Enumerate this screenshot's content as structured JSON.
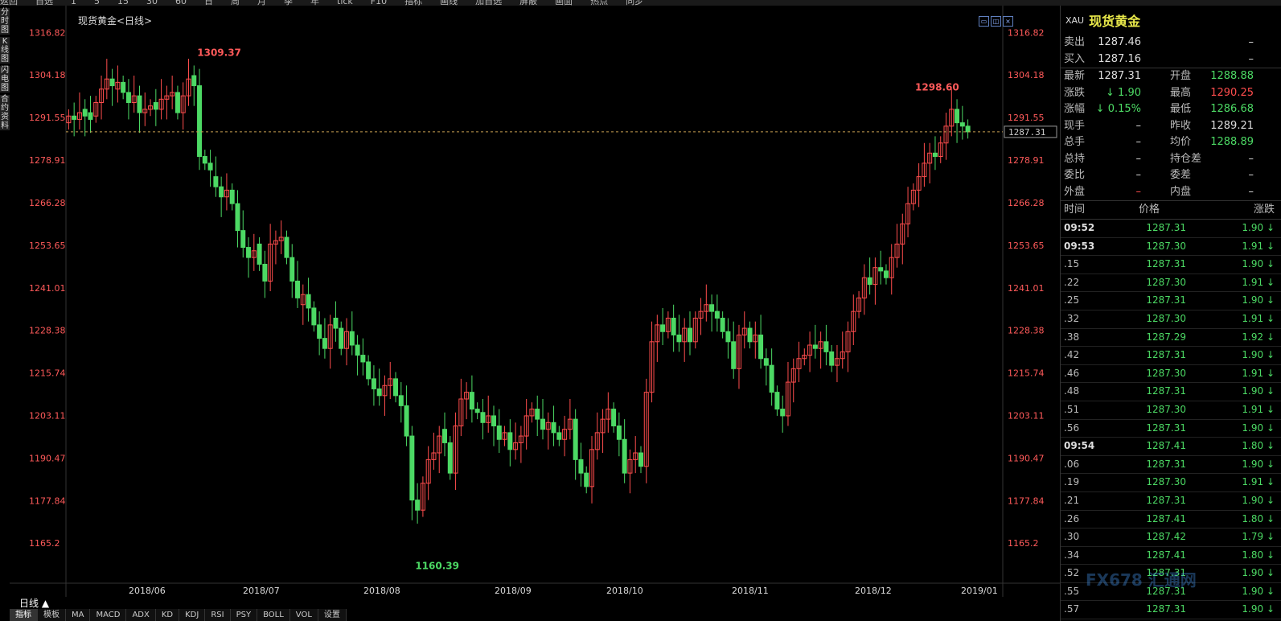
{
  "toolbar": {
    "items": [
      "返回",
      "自选",
      "1",
      "5",
      "15",
      "30",
      "60",
      "日",
      "周",
      "月",
      "季",
      "年",
      "tick",
      "F10",
      "指标",
      "画线",
      "加自选",
      "屏蔽",
      "画面",
      "热点",
      "同步"
    ]
  },
  "left_tabs": [
    "分时图",
    "K线图",
    "闪电图",
    "合约资料"
  ],
  "chart": {
    "title": "现货黄金<日线>",
    "period_label": "日线 ▲",
    "y_ticks": [
      1316.82,
      1304.18,
      1291.55,
      1278.91,
      1266.28,
      1253.65,
      1241.01,
      1228.38,
      1215.74,
      1203.11,
      1190.47,
      1177.84,
      1165.2
    ],
    "x_labels": [
      "2018/06",
      "2018/07",
      "2018/08",
      "2018/09",
      "2018/10",
      "2018/11",
      "2018/12",
      "2019/01"
    ],
    "high_label": "1309.37",
    "low_label": "1160.39",
    "recent_high_label": "1298.60",
    "current_price_label": "1287.31",
    "up_color": "#ff4d4d",
    "down_color": "#4cd964"
  },
  "chart_data": {
    "type": "candlestick",
    "title": "现货黄金<日线>",
    "x_labels": [
      "2018/06",
      "2018/07",
      "2018/08",
      "2018/09",
      "2018/10",
      "2018/11",
      "2018/12",
      "2019/01"
    ],
    "ylim": [
      1160.0,
      1320.0
    ],
    "y_ticks": [
      1316.82,
      1304.18,
      1291.55,
      1278.91,
      1266.28,
      1253.65,
      1241.01,
      1228.38,
      1215.74,
      1203.11,
      1190.47,
      1177.84,
      1165.2
    ],
    "highest": 1309.37,
    "lowest": 1160.39,
    "last": 1287.31,
    "closes": [
      1292,
      1291,
      1293,
      1292,
      1291,
      1296,
      1300,
      1303,
      1301,
      1302,
      1299,
      1296,
      1298,
      1293,
      1294,
      1295,
      1294,
      1297,
      1298,
      1299,
      1293,
      1298,
      1303,
      1301,
      1280,
      1278,
      1276,
      1271,
      1268,
      1270,
      1266,
      1258,
      1253,
      1250,
      1252,
      1248,
      1243,
      1254,
      1255,
      1256,
      1250,
      1243,
      1238,
      1239,
      1235,
      1230,
      1226,
      1223,
      1230,
      1229,
      1223,
      1228,
      1224,
      1221,
      1219,
      1214,
      1211,
      1209,
      1212,
      1214,
      1209,
      1206,
      1197,
      1178,
      1175,
      1183,
      1190,
      1192,
      1197,
      1195,
      1186,
      1200,
      1208,
      1210,
      1205,
      1204,
      1201,
      1203,
      1200,
      1196,
      1198,
      1193,
      1195,
      1197,
      1203,
      1205,
      1202,
      1199,
      1201,
      1198,
      1196,
      1199,
      1202,
      1190,
      1186,
      1182,
      1193,
      1198,
      1202,
      1205,
      1200,
      1196,
      1186,
      1190,
      1192,
      1188,
      1210,
      1225,
      1230,
      1228,
      1232,
      1227,
      1225,
      1229,
      1225,
      1232,
      1234,
      1236,
      1234,
      1232,
      1228,
      1225,
      1217,
      1227,
      1229,
      1225,
      1227,
      1220,
      1218,
      1210,
      1205,
      1203,
      1213,
      1217,
      1220,
      1221,
      1224,
      1223,
      1225,
      1222,
      1218,
      1220,
      1222,
      1228,
      1234,
      1238,
      1244,
      1242,
      1247,
      1246,
      1244,
      1250,
      1254,
      1260,
      1266,
      1270,
      1274,
      1278,
      1281,
      1280,
      1284,
      1289,
      1294,
      1290,
      1289,
      1287.31
    ],
    "opens": [
      1290,
      1292,
      1291,
      1294,
      1293,
      1292,
      1296,
      1300,
      1303,
      1300,
      1302,
      1299,
      1296,
      1298,
      1293,
      1294,
      1296,
      1294,
      1297,
      1298,
      1299,
      1293,
      1298,
      1304,
      1301,
      1280,
      1278,
      1274,
      1271,
      1268,
      1270,
      1266,
      1258,
      1253,
      1250,
      1254,
      1248,
      1243,
      1254,
      1255,
      1256,
      1250,
      1243,
      1236,
      1239,
      1235,
      1230,
      1226,
      1223,
      1232,
      1229,
      1223,
      1228,
      1224,
      1221,
      1219,
      1214,
      1211,
      1209,
      1212,
      1214,
      1209,
      1206,
      1197,
      1178,
      1175,
      1183,
      1190,
      1192,
      1199,
      1195,
      1186,
      1200,
      1208,
      1210,
      1205,
      1204,
      1201,
      1203,
      1200,
      1196,
      1198,
      1193,
      1195,
      1197,
      1203,
      1205,
      1202,
      1199,
      1201,
      1198,
      1196,
      1199,
      1202,
      1190,
      1186,
      1182,
      1193,
      1198,
      1202,
      1205,
      1200,
      1196,
      1186,
      1190,
      1192,
      1188,
      1210,
      1225,
      1230,
      1228,
      1232,
      1227,
      1225,
      1229,
      1225,
      1232,
      1234,
      1236,
      1234,
      1232,
      1228,
      1225,
      1217,
      1227,
      1229,
      1225,
      1227,
      1220,
      1218,
      1210,
      1205,
      1203,
      1213,
      1217,
      1220,
      1221,
      1224,
      1223,
      1225,
      1222,
      1218,
      1220,
      1222,
      1228,
      1234,
      1238,
      1244,
      1242,
      1247,
      1246,
      1244,
      1250,
      1254,
      1260,
      1266,
      1270,
      1274,
      1278,
      1281,
      1280,
      1284,
      1289,
      1294,
      1290,
      1289
    ]
  },
  "panel": {
    "code": "XAU",
    "name": "现货黄金",
    "quotes": [
      {
        "l1": "卖出",
        "v1": "1287.46",
        "c1": "white",
        "l2": "",
        "v2": "–",
        "c2": "white"
      },
      {
        "l1": "买入",
        "v1": "1287.16",
        "c1": "white",
        "l2": "",
        "v2": "–",
        "c2": "white"
      },
      {
        "l1": "最新",
        "v1": "1287.31",
        "c1": "white",
        "l2": "开盘",
        "v2": "1288.88",
        "c2": "green"
      },
      {
        "l1": "涨跌",
        "v1": "↓ 1.90",
        "c1": "green",
        "l2": "最高",
        "v2": "1290.25",
        "c2": "red"
      },
      {
        "l1": "涨幅",
        "v1": "↓ 0.15%",
        "c1": "green",
        "l2": "最低",
        "v2": "1286.68",
        "c2": "green"
      },
      {
        "l1": "现手",
        "v1": "–",
        "c1": "white",
        "l2": "昨收",
        "v2": "1289.21",
        "c2": "white"
      },
      {
        "l1": "总手",
        "v1": "–",
        "c1": "white",
        "l2": "均价",
        "v2": "1288.89",
        "c2": "green"
      },
      {
        "l1": "总持",
        "v1": "–",
        "c1": "white",
        "l2": "持仓差",
        "v2": "–",
        "c2": "white"
      },
      {
        "l1": "委比",
        "v1": "–",
        "c1": "white",
        "l2": "委差",
        "v2": "–",
        "c2": "white"
      },
      {
        "l1": "外盘",
        "v1": "–",
        "c1": "red",
        "l2": "内盘",
        "v2": "–",
        "c2": "white"
      }
    ],
    "tick_headers": [
      "时间",
      "价格",
      "涨跌"
    ],
    "ticks": [
      {
        "time": "09:52",
        "full": true,
        "price": "1287.31",
        "chg": "1.90 ↓"
      },
      {
        "time": "09:53",
        "full": true,
        "price": "1287.30",
        "chg": "1.91 ↓"
      },
      {
        "time": ".15",
        "full": false,
        "price": "1287.31",
        "chg": "1.90 ↓"
      },
      {
        "time": ".22",
        "full": false,
        "price": "1287.30",
        "chg": "1.91 ↓"
      },
      {
        "time": ".25",
        "full": false,
        "price": "1287.31",
        "chg": "1.90 ↓"
      },
      {
        "time": ".32",
        "full": false,
        "price": "1287.30",
        "chg": "1.91 ↓"
      },
      {
        "time": ".38",
        "full": false,
        "price": "1287.29",
        "chg": "1.92 ↓"
      },
      {
        "time": ".42",
        "full": false,
        "price": "1287.31",
        "chg": "1.90 ↓"
      },
      {
        "time": ".46",
        "full": false,
        "price": "1287.30",
        "chg": "1.91 ↓"
      },
      {
        "time": ".48",
        "full": false,
        "price": "1287.31",
        "chg": "1.90 ↓"
      },
      {
        "time": ".51",
        "full": false,
        "price": "1287.30",
        "chg": "1.91 ↓"
      },
      {
        "time": ".56",
        "full": false,
        "price": "1287.31",
        "chg": "1.90 ↓"
      },
      {
        "time": "09:54",
        "full": true,
        "price": "1287.41",
        "chg": "1.80 ↓"
      },
      {
        "time": ".06",
        "full": false,
        "price": "1287.31",
        "chg": "1.90 ↓"
      },
      {
        "time": ".19",
        "full": false,
        "price": "1287.30",
        "chg": "1.91 ↓"
      },
      {
        "time": ".21",
        "full": false,
        "price": "1287.31",
        "chg": "1.90 ↓"
      },
      {
        "time": ".26",
        "full": false,
        "price": "1287.41",
        "chg": "1.80 ↓"
      },
      {
        "time": ".30",
        "full": false,
        "price": "1287.42",
        "chg": "1.79 ↓"
      },
      {
        "time": ".34",
        "full": false,
        "price": "1287.41",
        "chg": "1.80 ↓"
      },
      {
        "time": ".52",
        "full": false,
        "price": "1287.31",
        "chg": "1.90 ↓"
      },
      {
        "time": ".55",
        "full": false,
        "price": "1287.31",
        "chg": "1.90 ↓"
      },
      {
        "time": ".57",
        "full": false,
        "price": "1287.31",
        "chg": "1.90 ↓"
      }
    ]
  },
  "indicators": [
    "指标",
    "模板",
    "MA",
    "MACD",
    "ADX",
    "KD",
    "KDJ",
    "RSI",
    "PSY",
    "BOLL",
    "VOL",
    "设置"
  ],
  "watermark": "FX678 汇通网"
}
